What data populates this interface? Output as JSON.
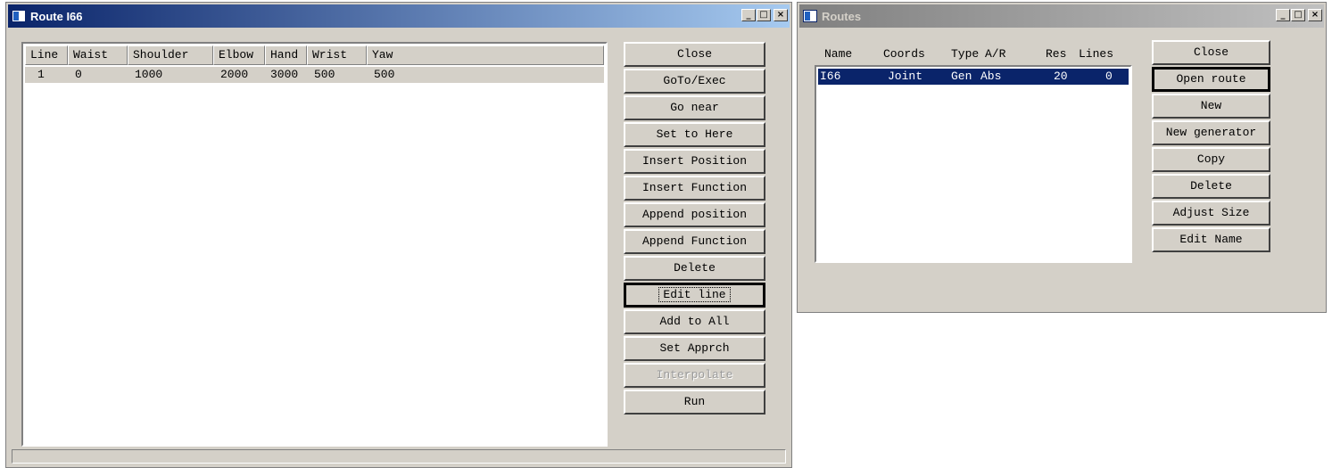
{
  "route_window": {
    "title": "Route I66",
    "title_buttons": [
      "_",
      "□",
      "×"
    ],
    "table": {
      "headers": [
        "Line",
        "Waist",
        "Shoulder",
        "Elbow",
        "Hand",
        "Wrist",
        "Yaw"
      ],
      "rows": [
        [
          "1",
          "0",
          "1000",
          "2000",
          "3000",
          "500",
          "500"
        ]
      ]
    },
    "buttons": [
      "Close",
      "GoTo/Exec",
      "Go near",
      "Set to Here",
      "Insert Position",
      "Insert Function",
      "Append position",
      "Append Function",
      "Delete",
      "Edit line",
      "Add to All",
      "Set Apprch",
      "Interpolate",
      "Run"
    ]
  },
  "routes_window": {
    "title": "Routes",
    "title_buttons": [
      "_",
      "□",
      "×"
    ],
    "list": {
      "headers": [
        "Name",
        "Coords",
        "Type",
        "A/R",
        "Res",
        "Lines"
      ],
      "rows": [
        [
          "I66",
          "Joint",
          "Gen",
          "Abs",
          "20",
          "0"
        ]
      ]
    },
    "buttons": [
      "Close",
      "Open route",
      "New",
      "New generator",
      "Copy",
      "Delete",
      "Adjust Size",
      "Edit Name"
    ]
  }
}
